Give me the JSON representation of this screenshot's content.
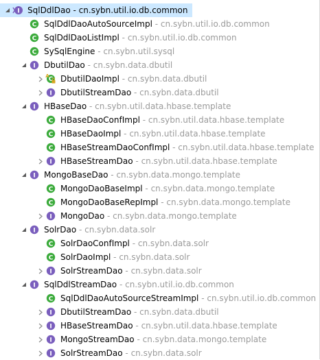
{
  "tree": {
    "separator": " - ",
    "rows": [
      {
        "depth": 0,
        "toggle": "expanded",
        "icon": "interface-hierarchy-icon",
        "name": "SqlDdlDao",
        "package": "cn.sybn.util.io.db.common",
        "selected": true
      },
      {
        "depth": 1,
        "toggle": "none",
        "icon": "class-icon",
        "name": "SqlDdlDaoAutoSourceImpl",
        "package": "cn.sybn.util.io.db.common"
      },
      {
        "depth": 1,
        "toggle": "none",
        "icon": "class-icon",
        "name": "SqlDdlDaoListImpl",
        "package": "cn.sybn.util.io.db.common"
      },
      {
        "depth": 1,
        "toggle": "none",
        "icon": "class-icon",
        "name": "SySqlEngine",
        "package": "cn.sybn.util.sysql"
      },
      {
        "depth": 1,
        "toggle": "expanded",
        "icon": "interface-icon",
        "name": "DbutilDao",
        "package": "cn.sybn.data.dbutil"
      },
      {
        "depth": 2,
        "toggle": "collapsed",
        "icon": "abstract-class-icon",
        "name": "DbutilDaoImpl",
        "package": "cn.sybn.data.dbutil"
      },
      {
        "depth": 2,
        "toggle": "collapsed",
        "icon": "interface-icon",
        "name": "DbutilStreamDao",
        "package": "cn.sybn.data.dbutil"
      },
      {
        "depth": 1,
        "toggle": "expanded",
        "icon": "interface-icon",
        "name": "HBaseDao",
        "package": "cn.sybn.util.data.hbase.template"
      },
      {
        "depth": 2,
        "toggle": "none",
        "icon": "class-icon",
        "name": "HBaseDaoConfImpl",
        "package": "cn.sybn.util.data.hbase.template"
      },
      {
        "depth": 2,
        "toggle": "none",
        "icon": "class-icon",
        "name": "HBaseDaoImpl",
        "package": "cn.sybn.util.data.hbase.template"
      },
      {
        "depth": 2,
        "toggle": "none",
        "icon": "class-icon",
        "name": "HBaseStreamDaoConfImpl",
        "package": "cn.sybn.util.data.hbase.template"
      },
      {
        "depth": 2,
        "toggle": "collapsed",
        "icon": "interface-icon",
        "name": "HBaseStreamDao",
        "package": "cn.sybn.util.data.hbase.template"
      },
      {
        "depth": 1,
        "toggle": "expanded",
        "icon": "interface-icon",
        "name": "MongoBaseDao",
        "package": "cn.sybn.data.mongo.template"
      },
      {
        "depth": 2,
        "toggle": "none",
        "icon": "class-icon",
        "name": "MongoDaoBaseImpl",
        "package": "cn.sybn.data.mongo.template"
      },
      {
        "depth": 2,
        "toggle": "none",
        "icon": "class-icon",
        "name": "MongoDaoBaseRepImpl",
        "package": "cn.sybn.data.mongo.template"
      },
      {
        "depth": 2,
        "toggle": "collapsed",
        "icon": "interface-icon",
        "name": "MongoDao",
        "package": "cn.sybn.data.mongo.template"
      },
      {
        "depth": 1,
        "toggle": "expanded",
        "icon": "interface-icon",
        "name": "SolrDao",
        "package": "cn.sybn.data.solr"
      },
      {
        "depth": 2,
        "toggle": "none",
        "icon": "class-icon",
        "name": "SolrDaoConfImpl",
        "package": "cn.sybn.data.solr"
      },
      {
        "depth": 2,
        "toggle": "none",
        "icon": "class-icon",
        "name": "SolrDaoImpl",
        "package": "cn.sybn.data.solr"
      },
      {
        "depth": 2,
        "toggle": "collapsed",
        "icon": "interface-icon",
        "name": "SolrStreamDao",
        "package": "cn.sybn.data.solr"
      },
      {
        "depth": 1,
        "toggle": "expanded",
        "icon": "interface-icon",
        "name": "SqlDdlStreamDao",
        "package": "cn.sybn.util.io.db.common"
      },
      {
        "depth": 2,
        "toggle": "none",
        "icon": "class-icon",
        "name": "SqlDdlDaoAutoSourceStreamImpl",
        "package": "cn.sybn.util.io.db.common"
      },
      {
        "depth": 2,
        "toggle": "collapsed",
        "icon": "interface-icon",
        "name": "DbutilStreamDao",
        "package": "cn.sybn.data.dbutil"
      },
      {
        "depth": 2,
        "toggle": "collapsed",
        "icon": "interface-icon",
        "name": "HBaseStreamDao",
        "package": "cn.sybn.util.data.hbase.template"
      },
      {
        "depth": 2,
        "toggle": "collapsed",
        "icon": "interface-icon",
        "name": "MongoStreamDao",
        "package": "cn.sybn.data.mongo.template"
      },
      {
        "depth": 2,
        "toggle": "collapsed",
        "icon": "interface-icon",
        "name": "SolrStreamDao",
        "package": "cn.sybn.data.solr"
      }
    ]
  },
  "colors": {
    "class_icon": "#3cab3c",
    "interface_icon": "#7a5ebd",
    "abstract_icon": "#d9a520",
    "selection": "#cce8ff",
    "package_text": "#9a9a9a"
  }
}
